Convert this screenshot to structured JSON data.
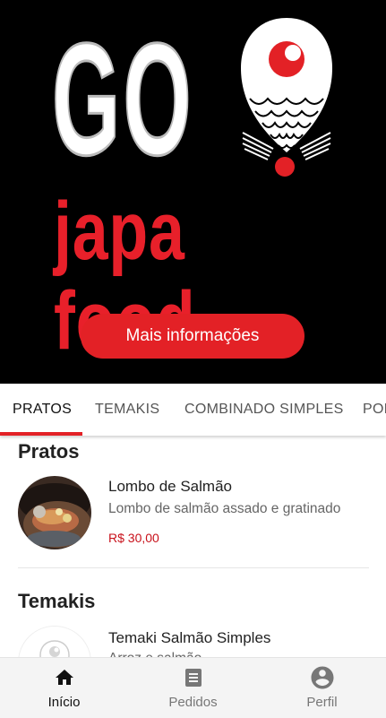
{
  "brand": {
    "name_main": "GO",
    "name_sub": "japa food",
    "accent": "#e32126"
  },
  "hero": {
    "button_label": "Mais informações"
  },
  "tabs": [
    {
      "label": "PRATOS",
      "active": true
    },
    {
      "label": "TEMAKIS",
      "active": false
    },
    {
      "label": "COMBINADO SIMPLES",
      "active": false
    },
    {
      "label": "POR",
      "active": false
    }
  ],
  "sections": [
    {
      "title": "Pratos",
      "items": [
        {
          "name": "Lombo de Salmão",
          "description": "Lombo de salmão assado e gratinado",
          "price": "R$ 30,00",
          "image": "food-photo"
        }
      ]
    },
    {
      "title": "Temakis",
      "items": [
        {
          "name": "Temaki Salmão Simples",
          "description": "Arroz e salmão",
          "image": "logo-placeholder"
        }
      ]
    }
  ],
  "bottom_nav": [
    {
      "label": "Início",
      "icon": "home-icon",
      "active": true
    },
    {
      "label": "Pedidos",
      "icon": "receipt-icon",
      "active": false
    },
    {
      "label": "Perfil",
      "icon": "account-circle-icon",
      "active": false
    }
  ]
}
